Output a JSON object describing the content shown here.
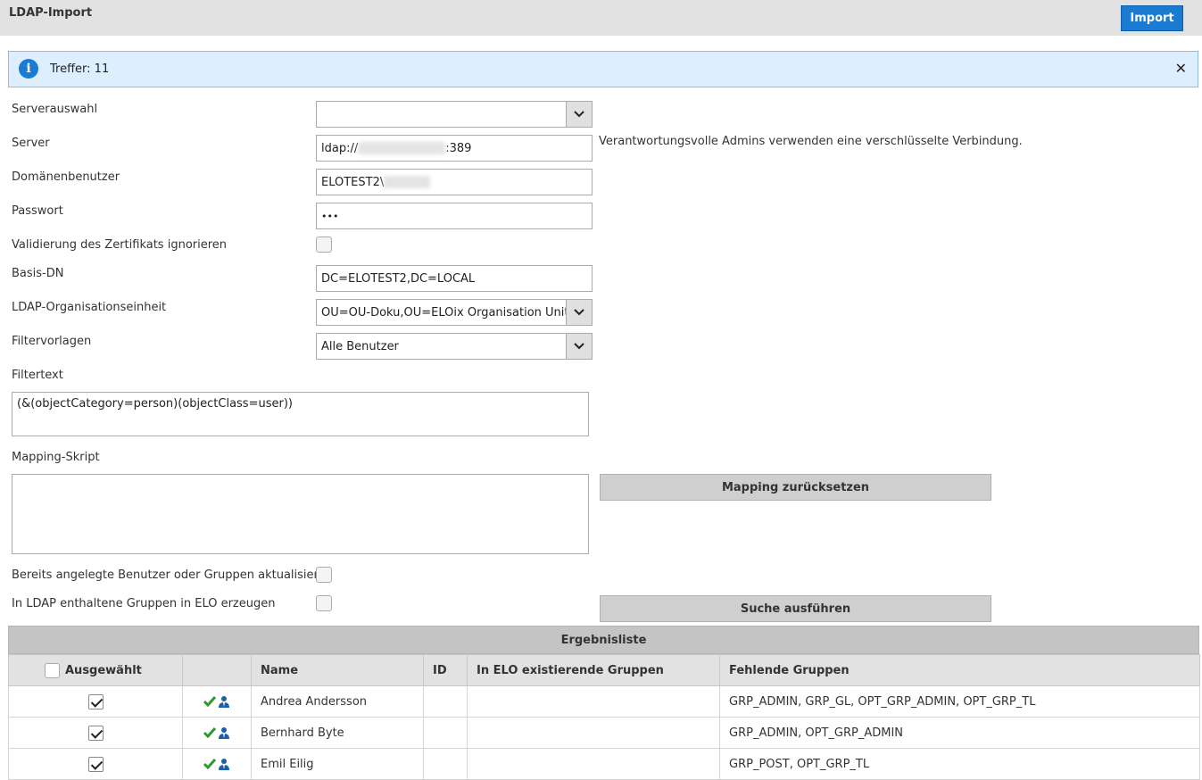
{
  "header": {
    "title": "LDAP-Import",
    "import_label": "Import"
  },
  "info": {
    "text": "Treffer: 11",
    "close": "✕"
  },
  "form": {
    "server_select_label": "Serverauswahl",
    "server_label": "Server",
    "server_prefix": "ldap://",
    "server_port": ":389",
    "server_hint": "Verantwortungsvolle Admins verwenden eine verschlüsselte Verbindung.",
    "domain_user_label": "Domänenbenutzer",
    "domain_user_value": "ELOTEST2\\",
    "password_label": "Passwort",
    "password_value": "•••",
    "ignore_cert_label": "Validierung des Zertifikats ignorieren",
    "base_dn_label": "Basis-DN",
    "base_dn_value": "DC=ELOTEST2,DC=LOCAL",
    "ou_label": "LDAP-Organisationseinheit",
    "ou_value": "OU=OU-Doku,OU=ELOix Organisation Unit f",
    "filter_templates_label": "Filtervorlagen",
    "filter_template_value": "Alle Benutzer",
    "filter_text_label": "Filtertext",
    "filter_text_value": "(&(objectCategory=person)(objectClass=user))",
    "mapping_label": "Mapping-Skript",
    "mapping_reset_label": "Mapping zurücksetzen",
    "update_existing_label": "Bereits angelegte Benutzer oder Gruppen aktualisieren",
    "create_groups_label": "In LDAP enthaltene Gruppen in ELO erzeugen",
    "search_label": "Suche ausführen"
  },
  "results": {
    "title": "Ergebnisliste",
    "columns": [
      "Ausgewählt",
      "",
      "Name",
      "ID",
      "In ELO existierende Gruppen",
      "Fehlende Gruppen"
    ],
    "rows": [
      {
        "name": "Andrea Andersson",
        "id": "",
        "existing": "",
        "missing": "GRP_ADMIN, GRP_GL, OPT_GRP_ADMIN, OPT_GRP_TL"
      },
      {
        "name": "Bernhard Byte",
        "id": "",
        "existing": "",
        "missing": "GRP_ADMIN, OPT_GRP_ADMIN"
      },
      {
        "name": "Emil Eilig",
        "id": "",
        "existing": "",
        "missing": "GRP_POST, OPT_GRP_TL"
      }
    ]
  },
  "colors": {
    "accent": "#1a7bd3",
    "info_bg": "#ddeeff",
    "check_green": "#2e9a2e"
  }
}
